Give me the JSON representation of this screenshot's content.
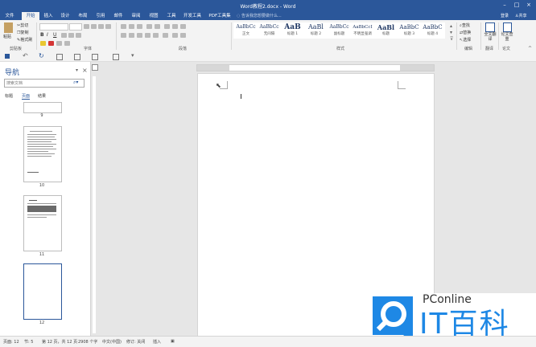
{
  "window": {
    "title": "Word教程2.docx - Word"
  },
  "tabs": [
    "文件",
    "开始",
    "插入",
    "设计",
    "布局",
    "引用",
    "邮件",
    "审阅",
    "视图",
    "工具",
    "开发工具",
    "PDF工具集"
  ],
  "tell_me": "告诉我您想要做什么...",
  "account": {
    "login": "登录",
    "share": "共享"
  },
  "ribbon": {
    "clipboard": {
      "paste": "粘贴",
      "cut": "剪切",
      "copy": "复制",
      "format_painter": "格式刷",
      "label": "剪贴板"
    },
    "font": {
      "label": "字体"
    },
    "paragraph": {
      "label": "段落"
    },
    "styles": {
      "label": "样式",
      "items": [
        {
          "preview": "AaBbCc",
          "name": "正文"
        },
        {
          "preview": "AaBbCc",
          "name": "无间隔"
        },
        {
          "preview": "AaB",
          "name": "标题 1"
        },
        {
          "preview": "AaBl",
          "name": "标题 2"
        },
        {
          "preview": "AaBbCc",
          "name": "副标题"
        },
        {
          "preview": "AaBbCcI",
          "name": "不明显强调"
        },
        {
          "preview": "AaBl",
          "name": "标题"
        },
        {
          "preview": "AaBbC",
          "name": "标题 3"
        },
        {
          "preview": "AaBbC",
          "name": "标题 4"
        }
      ]
    },
    "editing": {
      "find": "查找",
      "replace": "替换",
      "select": "选择",
      "label": "编辑"
    },
    "translate": {
      "full_text": "全文翻译",
      "label": "翻译"
    },
    "paper": {
      "check": "论文查重",
      "label": "论文"
    }
  },
  "nav": {
    "title": "导航",
    "search_placeholder": "搜索文档",
    "tabs": [
      "标题",
      "页面",
      "结果"
    ],
    "pages": [
      "9",
      "10",
      "11",
      "12"
    ]
  },
  "status": {
    "page": "页面: 12",
    "section": "节: 5",
    "page_of": "第 12 页，共 12 页",
    "words": "2908 个字",
    "language": "中文(中国)",
    "track": "修订: 关闭",
    "mode": "插入"
  },
  "watermark": {
    "brand": "PConline",
    "name": "IT百科"
  }
}
